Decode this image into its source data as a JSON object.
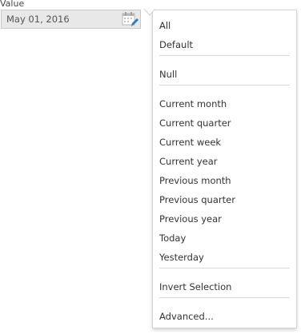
{
  "field": {
    "label": "Value",
    "value": "May 01, 2016"
  },
  "icons": {
    "calendar": "calendar-edit-icon",
    "caret": "dropdown-pointer-icon"
  },
  "colors": {
    "field_bg": "#e8e8e8",
    "calendar_blue": "#2f78c4",
    "calendar_grey": "#b8b8b8"
  },
  "menu": {
    "groups": [
      [
        "All",
        "Default"
      ],
      [
        "Null"
      ],
      [
        "Current month",
        "Current quarter",
        "Current week",
        "Current year",
        "Previous month",
        "Previous quarter",
        "Previous year",
        "Today",
        "Yesterday"
      ],
      [
        "Invert Selection"
      ],
      [
        "Advanced..."
      ]
    ]
  }
}
